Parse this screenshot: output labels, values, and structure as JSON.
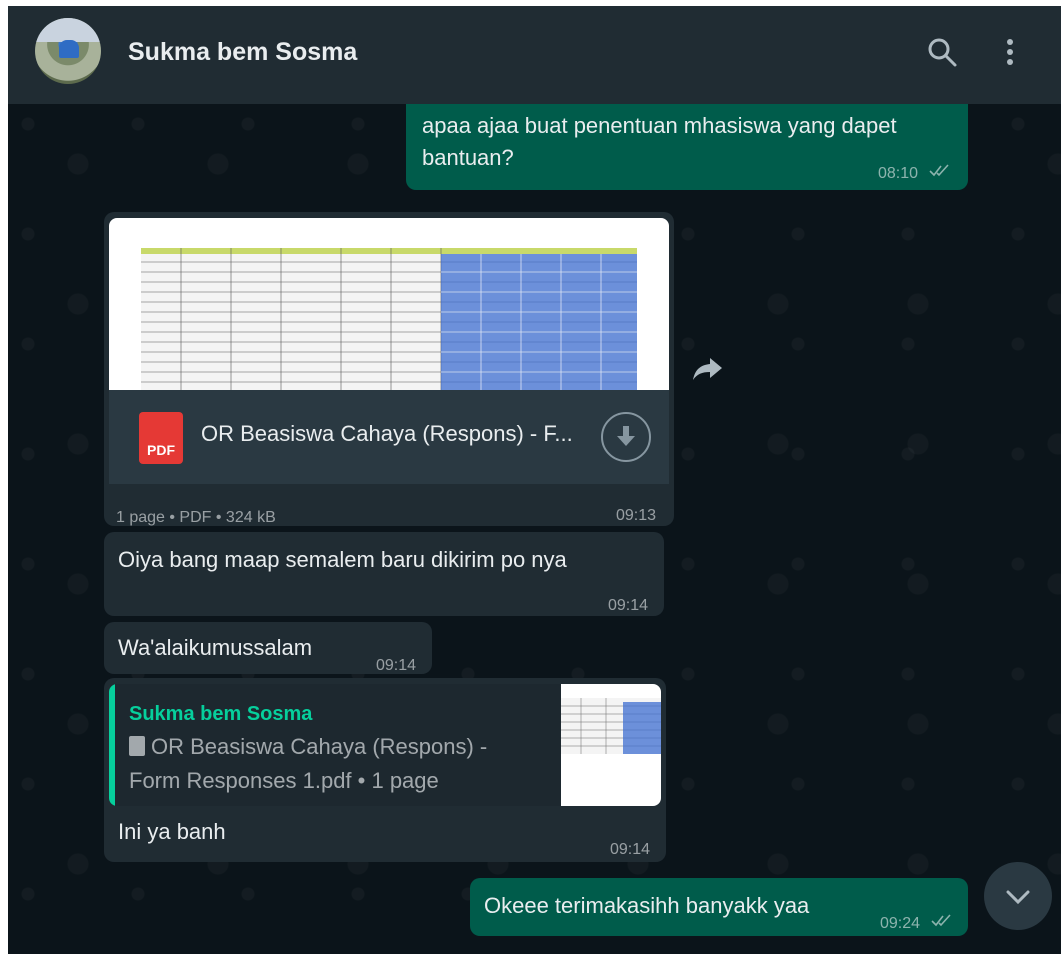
{
  "header": {
    "contact_name": "Sukma bem Sosma"
  },
  "icons": {
    "search": "search-icon",
    "menu": "more-vertical-icon",
    "forward": "forward-icon",
    "download": "download-icon",
    "scroll_down": "chevron-down-icon",
    "read_ticks": "double-check-icon",
    "doc": "document-icon"
  },
  "messages": [
    {
      "id": "m1",
      "direction": "outgoing",
      "text_line1": "apaa ajaa buat penentuan mhasiswa yang dapet",
      "text_line2": "bantuan?",
      "time": "08:10"
    },
    {
      "id": "m2",
      "direction": "incoming",
      "type": "pdf",
      "file_name": "OR Beasiswa Cahaya (Respons) - F...",
      "file_badge": "PDF",
      "meta": "1 page • PDF • 324 kB",
      "time": "09:13"
    },
    {
      "id": "m3",
      "direction": "incoming",
      "text": "Oiya bang maap semalem baru dikirim po nya",
      "time": "09:14"
    },
    {
      "id": "m4",
      "direction": "incoming",
      "text": "Wa'alaikumussalam",
      "time": "09:14"
    },
    {
      "id": "m5",
      "direction": "incoming",
      "quote_name": "Sukma bem Sosma",
      "quote_text": "OR Beasiswa Cahaya (Respons) - Form Responses 1.pdf • 1 page",
      "text": "Ini ya banh",
      "time": "09:14"
    },
    {
      "id": "m6",
      "direction": "outgoing",
      "text": "Okeee terimakasihh banyakk yaa",
      "time": "09:24"
    }
  ],
  "colors": {
    "header_bg": "#202c33",
    "chat_bg": "#0b141a",
    "outgoing_bubble": "#005c4b",
    "incoming_bubble": "#202c33",
    "accent": "#06cf9c",
    "pdf_red": "#e53935"
  }
}
